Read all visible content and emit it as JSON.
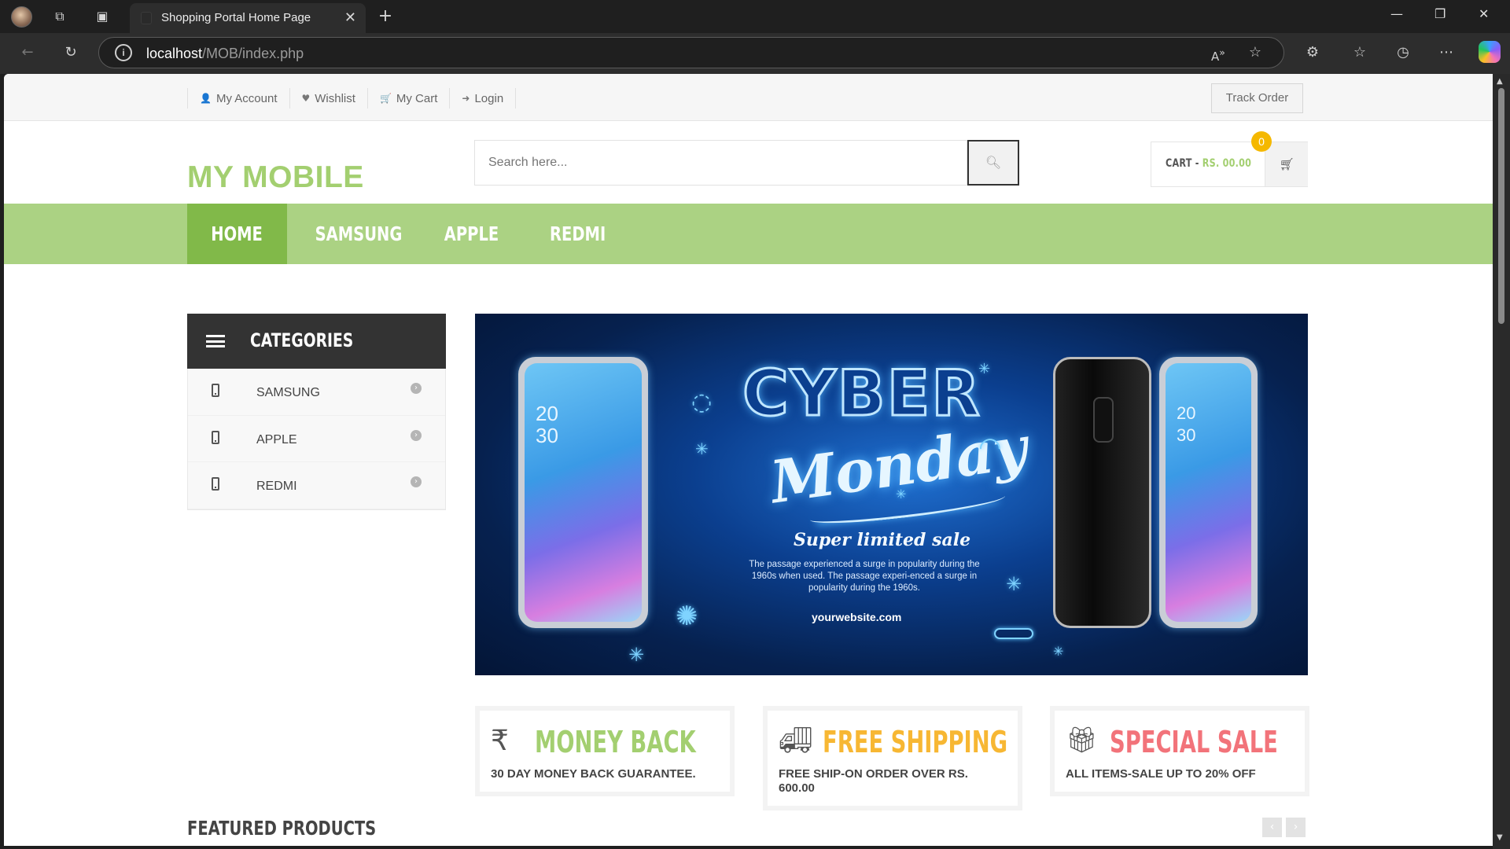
{
  "browser": {
    "tab_title": "Shopping Portal Home Page",
    "url_host": "localhost",
    "url_path": "/MOB/index.php"
  },
  "topbar": {
    "links": [
      {
        "icon": "user-icon",
        "label": "My Account"
      },
      {
        "icon": "heart-icon",
        "label": "Wishlist"
      },
      {
        "icon": "cart-icon",
        "label": "My Cart"
      },
      {
        "icon": "sign-in-icon",
        "label": "Login"
      }
    ],
    "track_order": "Track Order"
  },
  "header": {
    "logo": "MY MOBILE",
    "search_placeholder": "Search here...",
    "cart_label": "CART -",
    "cart_amount": "RS. 00.00",
    "cart_count": "0"
  },
  "nav": {
    "items": [
      "HOME",
      "SAMSUNG",
      "APPLE",
      "REDMI"
    ]
  },
  "categories": {
    "title": "CATEGORIES",
    "items": [
      "SAMSUNG",
      "APPLE",
      "REDMI"
    ]
  },
  "banner": {
    "headline": "CYBER",
    "script": "Monday",
    "sale": "Super limited sale",
    "description": "The passage experienced a surge in popularity during the 1960s when used. The passage experi-enced a surge in popularity during the 1960s.",
    "url": "yourwebsite.com",
    "phone_time_hour": "20",
    "phone_time_min": "30"
  },
  "features": [
    {
      "icon": "rupee-icon",
      "title": "MONEY BACK",
      "subtitle": "30 DAY MONEY BACK GUARANTEE.",
      "color": "#a3cf70"
    },
    {
      "icon": "truck-icon",
      "title": "FREE SHIPPING",
      "subtitle": "FREE SHIP-ON ORDER OVER RS. 600.00",
      "color": "#f7b733"
    },
    {
      "icon": "gift-icon",
      "title": "SPECIAL SALE",
      "subtitle": "ALL ITEMS-SALE UP TO 20% OFF",
      "color": "#f2737a"
    }
  ],
  "featured": {
    "title": "FEATURED PRODUCTS",
    "prev": "‹",
    "next": "›"
  },
  "colors": {
    "accent_green": "#abd283",
    "active_green": "#81b949",
    "dark": "#333333"
  }
}
